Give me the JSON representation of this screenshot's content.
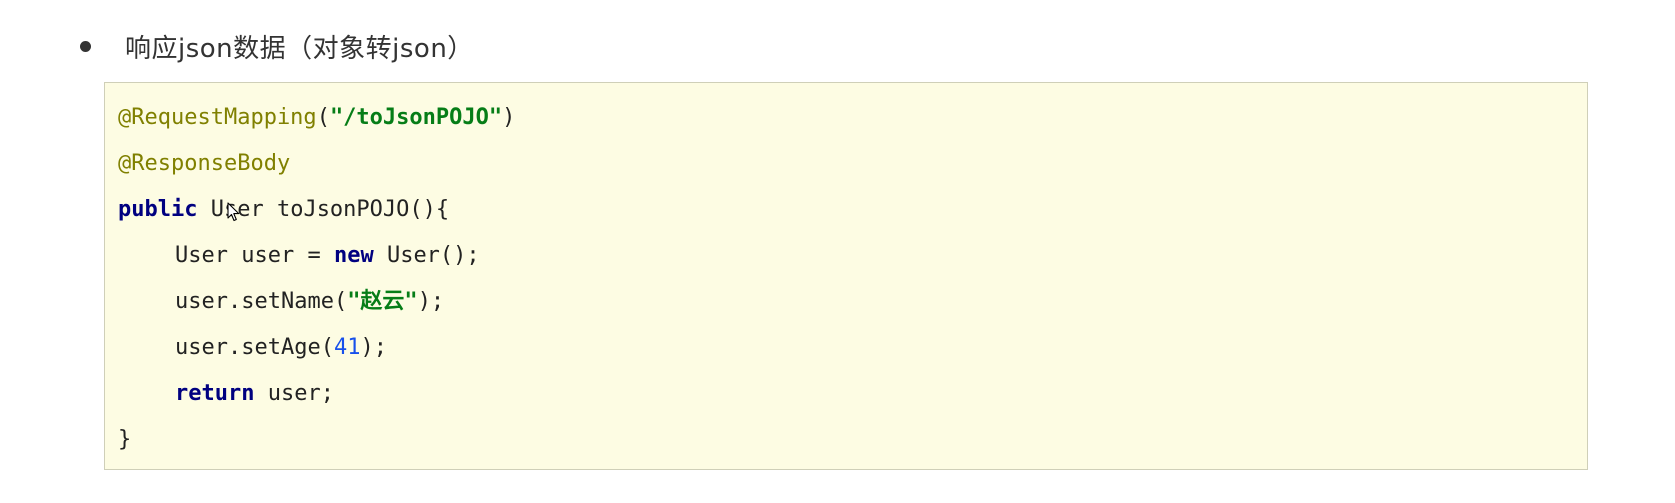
{
  "bullet": {
    "text": "响应json数据（对象转json）"
  },
  "code": {
    "line1": {
      "annotation": "@RequestMapping",
      "paren_open": "(",
      "string": "\"/toJsonPOJO\"",
      "paren_close": ")"
    },
    "line2": {
      "annotation": "@ResponseBody"
    },
    "line3": {
      "keyword": "public",
      "rest": " User toJsonPOJO(){"
    },
    "line4": {
      "pre": "User user = ",
      "keyword": "new",
      "post": " User();"
    },
    "line5": {
      "pre": "user.setName(",
      "string": "\"赵云\"",
      "post": ");"
    },
    "line6": {
      "pre": "user.setAge(",
      "number": "41",
      "post": ");"
    },
    "line7": {
      "keyword": "return",
      "post": " user;"
    },
    "line8": {
      "text": "}"
    }
  },
  "icons": {
    "cursor": "mouse-pointer-icon"
  },
  "colors": {
    "code_background": "#fdfce3",
    "annotation": "#808000",
    "string": "#067d17",
    "keyword": "#000080",
    "number": "#1750eb"
  }
}
